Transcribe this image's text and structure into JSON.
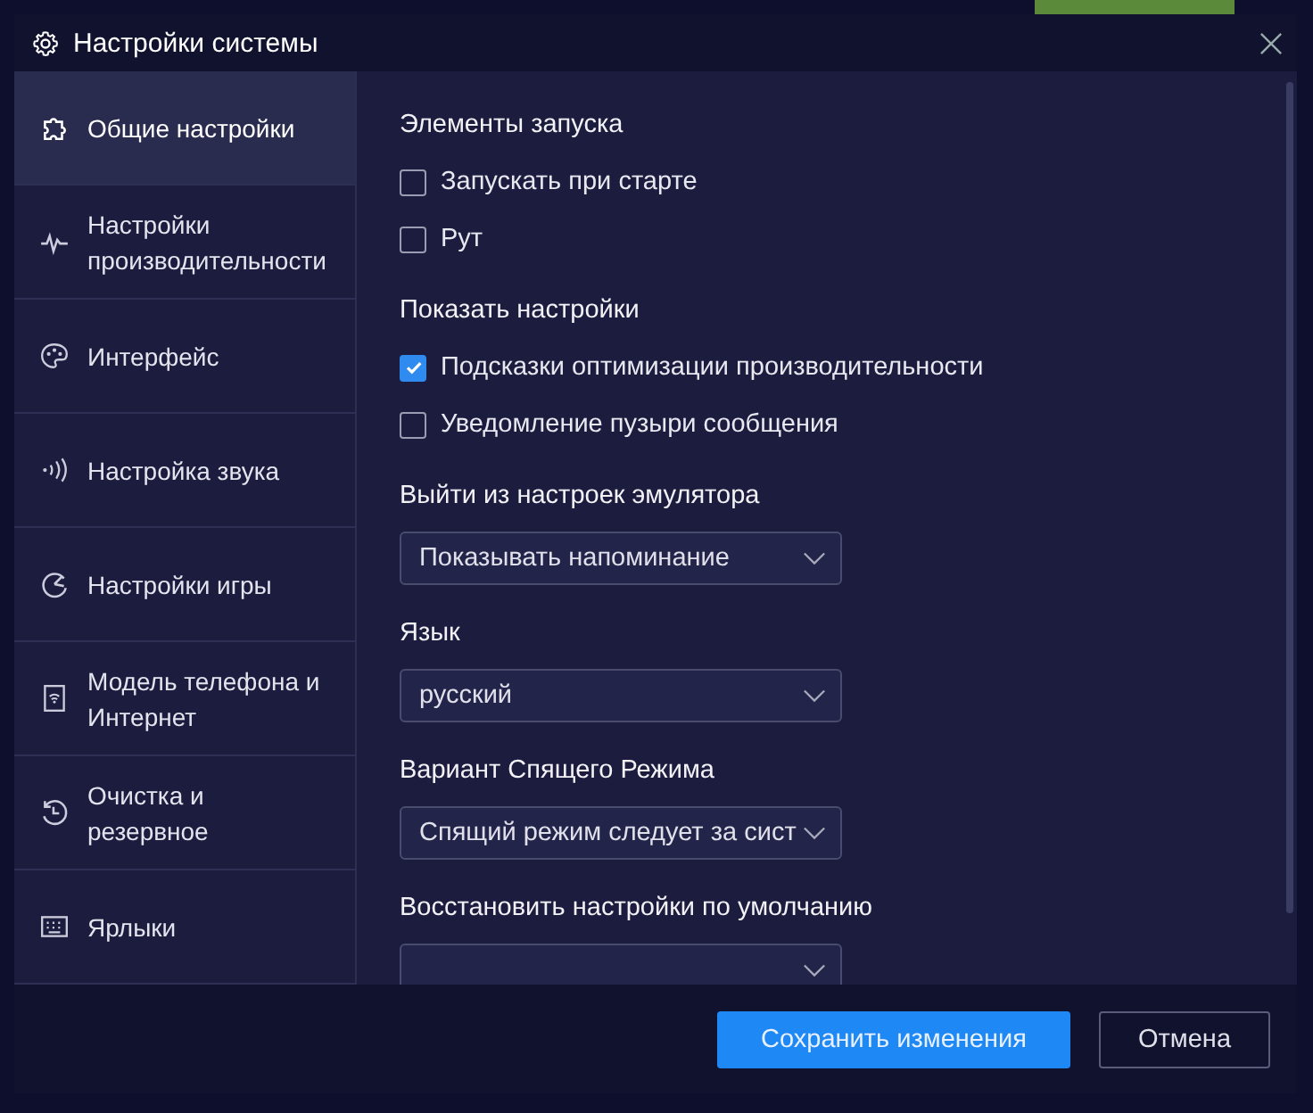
{
  "window": {
    "title": "Настройки системы"
  },
  "sidebar": {
    "items": [
      {
        "label": "Общие настройки",
        "selected": true
      },
      {
        "label": "Настройки производительности",
        "selected": false
      },
      {
        "label": "Интерфейс",
        "selected": false
      },
      {
        "label": "Настройка звука",
        "selected": false
      },
      {
        "label": "Настройки игры",
        "selected": false
      },
      {
        "label": "Модель телефона и Интернет",
        "selected": false
      },
      {
        "label": "Очистка и резервное",
        "selected": false
      },
      {
        "label": "Ярлыки",
        "selected": false
      }
    ]
  },
  "sections": [
    {
      "kind": "checkboxes",
      "title": "Элементы запуска",
      "options": [
        {
          "label": "Запускать при старте",
          "checked": false
        },
        {
          "label": "Рут",
          "checked": false
        }
      ]
    },
    {
      "kind": "checkboxes",
      "title": "Показать настройки",
      "options": [
        {
          "label": "Подсказки оптимизации производительности",
          "checked": true
        },
        {
          "label": "Уведомление пузыри сообщения",
          "checked": false
        }
      ]
    },
    {
      "kind": "dropdown",
      "title": "Выйти из настроек эмулятора",
      "value": "Показывать напоминание"
    },
    {
      "kind": "dropdown",
      "title": "Язык",
      "value": "русский"
    },
    {
      "kind": "dropdown",
      "title": "Вариант Спящего Режима",
      "value": "Спящий режим следует за сист"
    },
    {
      "kind": "dropdown",
      "title": "Восстановить настройки по умолчанию"
    }
  ],
  "buttons": [
    {
      "label": "Сохранить изменения",
      "kind": "primary"
    },
    {
      "label": "Отмена",
      "kind": "secondary"
    }
  ]
}
